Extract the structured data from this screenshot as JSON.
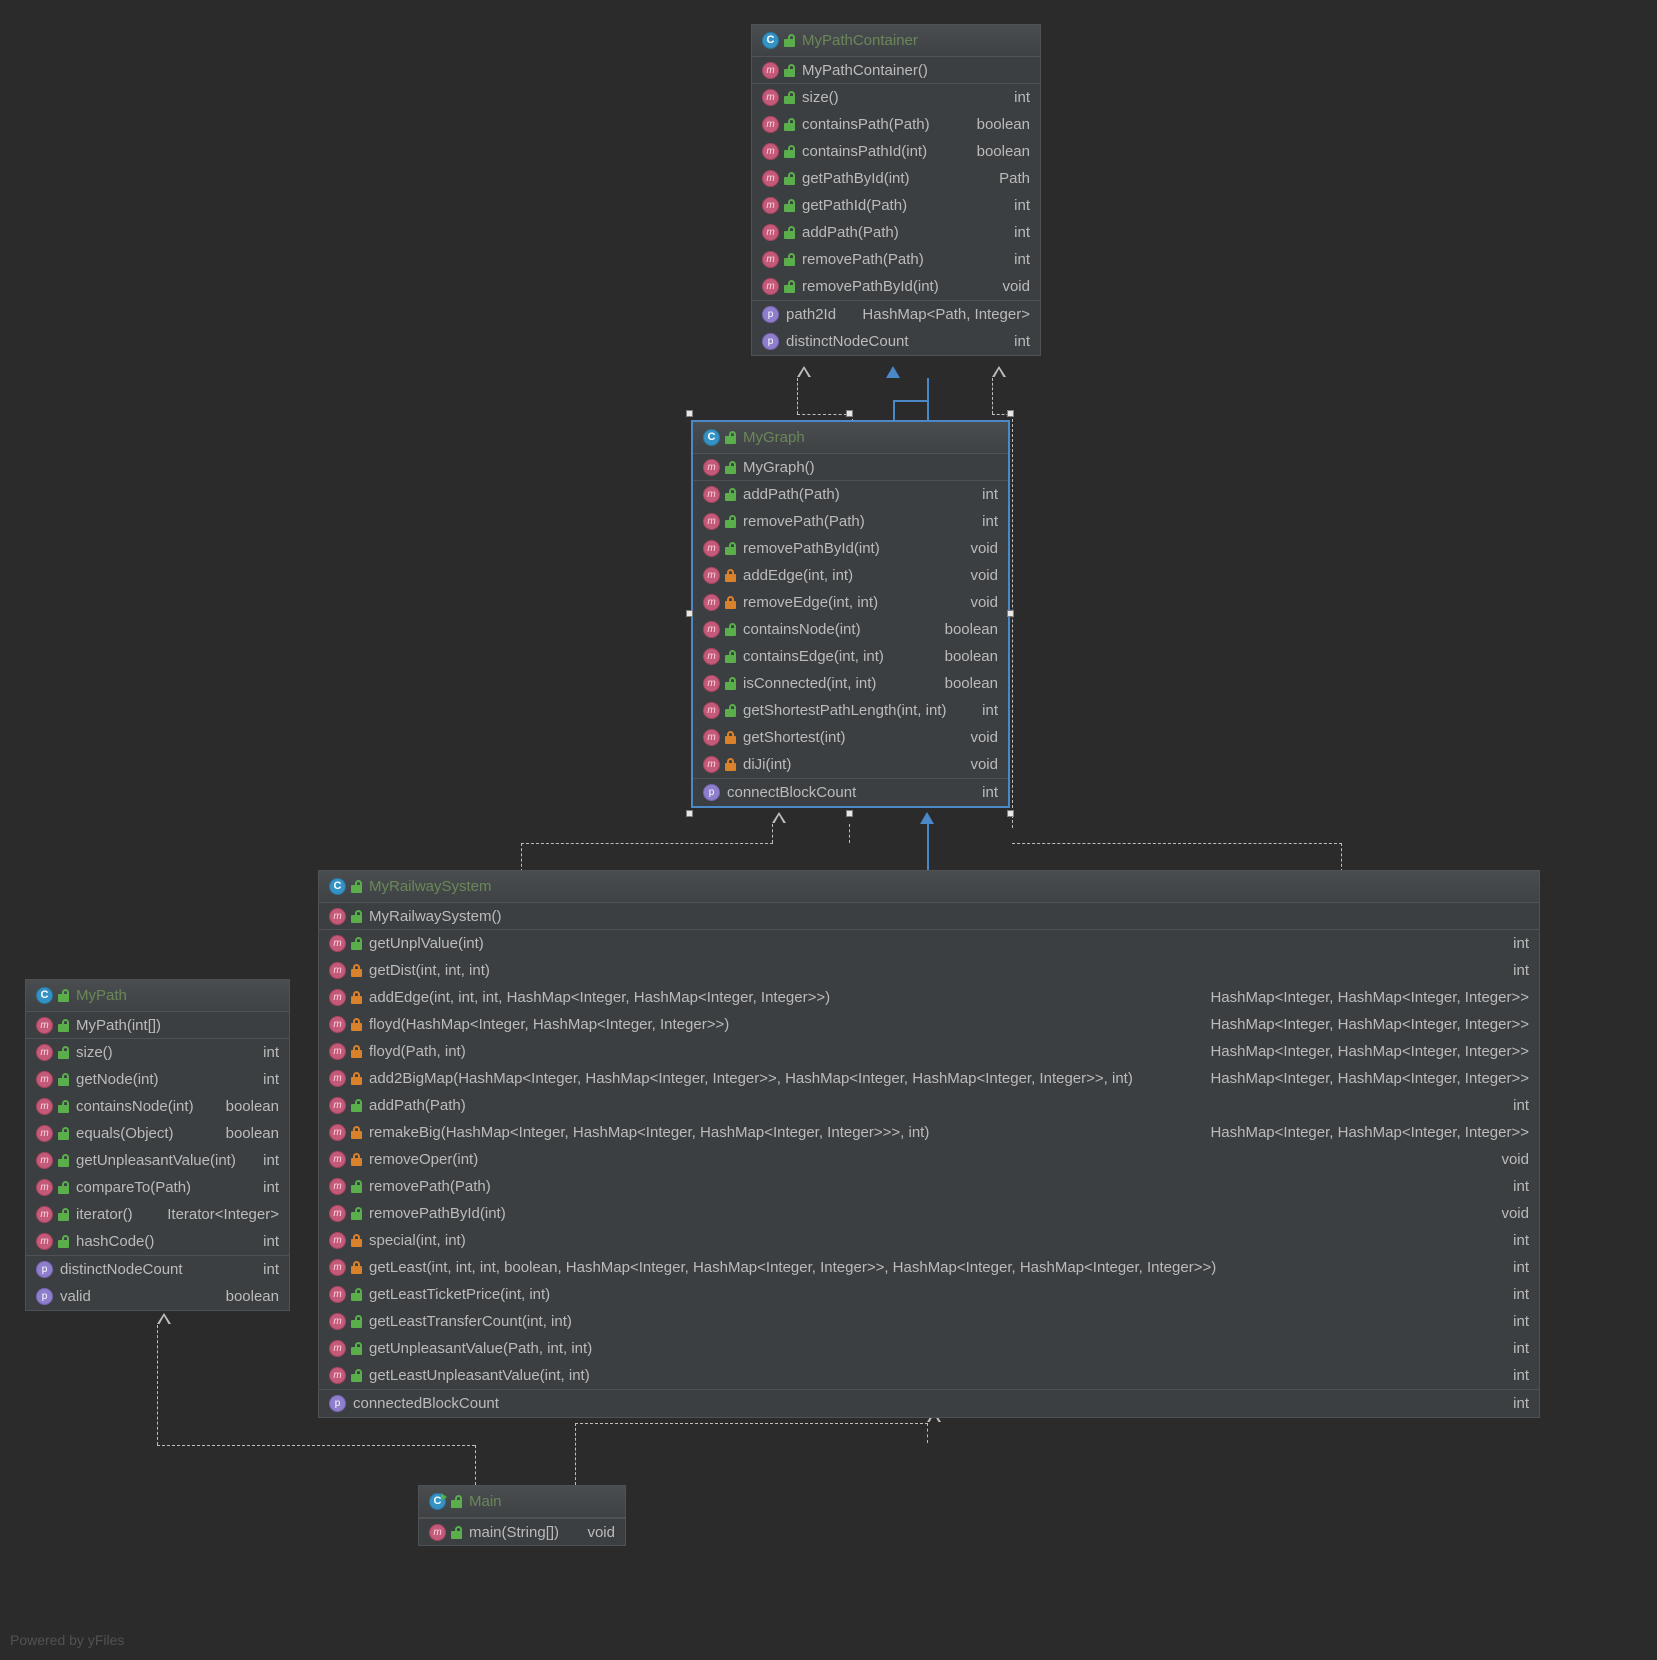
{
  "watermark": "Powered by yFiles",
  "icons": {
    "class": "class-icon",
    "method": "method-icon",
    "field": "field-icon",
    "public": "unlock-icon",
    "private": "lock-icon",
    "runnable": "run-arrow-icon"
  },
  "colors": {
    "background": "#2b2b2b",
    "box_fill": "#3c3f41",
    "box_border": "#4e5254",
    "selection_border": "#4a88c7",
    "class_name": "#6a8759",
    "member_text": "#bbbbbb",
    "class_icon": "#3592c4",
    "method_icon": "#c45a7a",
    "field_icon": "#8f7ecb",
    "public_icon": "#5aaf4c",
    "private_icon": "#d9822b",
    "inheritance_line": "#4a88c7",
    "dependency_line": "#bdbdbd"
  },
  "classes": {
    "mypathcontainer": {
      "name": "MyPathContainer",
      "icon": "class-icon",
      "visibility": "public",
      "constructor": {
        "label": "MyPathContainer()",
        "visibility": "public",
        "rtype": ""
      },
      "methods": [
        {
          "label": "size()",
          "visibility": "public",
          "rtype": "int"
        },
        {
          "label": "containsPath(Path)",
          "visibility": "public",
          "rtype": "boolean"
        },
        {
          "label": "containsPathId(int)",
          "visibility": "public",
          "rtype": "boolean"
        },
        {
          "label": "getPathById(int)",
          "visibility": "public",
          "rtype": "Path"
        },
        {
          "label": "getPathId(Path)",
          "visibility": "public",
          "rtype": "int"
        },
        {
          "label": "addPath(Path)",
          "visibility": "public",
          "rtype": "int"
        },
        {
          "label": "removePath(Path)",
          "visibility": "public",
          "rtype": "int"
        },
        {
          "label": "removePathById(int)",
          "visibility": "public",
          "rtype": "void"
        }
      ],
      "fields": [
        {
          "label": "path2Id",
          "rtype": "HashMap<Path, Integer>"
        },
        {
          "label": "distinctNodeCount",
          "rtype": "int"
        }
      ]
    },
    "mygraph": {
      "name": "MyGraph",
      "icon": "class-icon",
      "visibility": "public",
      "selected": true,
      "constructor": {
        "label": "MyGraph()",
        "visibility": "public",
        "rtype": ""
      },
      "methods": [
        {
          "label": "addPath(Path)",
          "visibility": "public",
          "rtype": "int"
        },
        {
          "label": "removePath(Path)",
          "visibility": "public",
          "rtype": "int"
        },
        {
          "label": "removePathById(int)",
          "visibility": "public",
          "rtype": "void"
        },
        {
          "label": "addEdge(int, int)",
          "visibility": "private",
          "rtype": "void"
        },
        {
          "label": "removeEdge(int, int)",
          "visibility": "private",
          "rtype": "void"
        },
        {
          "label": "containsNode(int)",
          "visibility": "public",
          "rtype": "boolean"
        },
        {
          "label": "containsEdge(int, int)",
          "visibility": "public",
          "rtype": "boolean"
        },
        {
          "label": "isConnected(int, int)",
          "visibility": "public",
          "rtype": "boolean"
        },
        {
          "label": "getShortestPathLength(int, int)",
          "visibility": "public",
          "rtype": "int"
        },
        {
          "label": "getShortest(int)",
          "visibility": "private",
          "rtype": "void"
        },
        {
          "label": "diJi(int)",
          "visibility": "private",
          "rtype": "void"
        }
      ],
      "fields": [
        {
          "label": "connectBlockCount",
          "rtype": "int"
        }
      ]
    },
    "myrailwaysystem": {
      "name": "MyRailwaySystem",
      "icon": "class-icon",
      "visibility": "public",
      "constructor": {
        "label": "MyRailwaySystem()",
        "visibility": "public",
        "rtype": ""
      },
      "methods": [
        {
          "label": "getUnplValue(int)",
          "visibility": "public",
          "rtype": "int"
        },
        {
          "label": "getDist(int, int, int)",
          "visibility": "private",
          "rtype": "int"
        },
        {
          "label": "addEdge(int, int, int, HashMap<Integer, HashMap<Integer, Integer>>)",
          "visibility": "private",
          "rtype": "HashMap<Integer, HashMap<Integer, Integer>>"
        },
        {
          "label": "floyd(HashMap<Integer, HashMap<Integer, Integer>>)",
          "visibility": "private",
          "rtype": "HashMap<Integer, HashMap<Integer, Integer>>"
        },
        {
          "label": "floyd(Path, int)",
          "visibility": "private",
          "rtype": "HashMap<Integer, HashMap<Integer, Integer>>"
        },
        {
          "label": "add2BigMap(HashMap<Integer, HashMap<Integer, Integer>>, HashMap<Integer, HashMap<Integer, Integer>>, int)",
          "visibility": "private",
          "rtype": "HashMap<Integer, HashMap<Integer, Integer>>"
        },
        {
          "label": "addPath(Path)",
          "visibility": "public",
          "rtype": "int"
        },
        {
          "label": "remakeBig(HashMap<Integer, HashMap<Integer, HashMap<Integer, Integer>>>, int)",
          "visibility": "private",
          "rtype": "HashMap<Integer, HashMap<Integer, Integer>>"
        },
        {
          "label": "removeOper(int)",
          "visibility": "private",
          "rtype": "void"
        },
        {
          "label": "removePath(Path)",
          "visibility": "public",
          "rtype": "int"
        },
        {
          "label": "removePathById(int)",
          "visibility": "public",
          "rtype": "void"
        },
        {
          "label": "special(int, int)",
          "visibility": "private",
          "rtype": "int"
        },
        {
          "label": "getLeast(int, int, int, boolean, HashMap<Integer, HashMap<Integer, Integer>>, HashMap<Integer, HashMap<Integer, Integer>>)",
          "visibility": "private",
          "rtype": "int"
        },
        {
          "label": "getLeastTicketPrice(int, int)",
          "visibility": "public",
          "rtype": "int"
        },
        {
          "label": "getLeastTransferCount(int, int)",
          "visibility": "public",
          "rtype": "int"
        },
        {
          "label": "getUnpleasantValue(Path, int, int)",
          "visibility": "public",
          "rtype": "int"
        },
        {
          "label": "getLeastUnpleasantValue(int, int)",
          "visibility": "public",
          "rtype": "int"
        }
      ],
      "fields": [
        {
          "label": "connectedBlockCount",
          "rtype": "int"
        }
      ]
    },
    "mypath": {
      "name": "MyPath",
      "icon": "class-icon",
      "visibility": "public",
      "constructor": {
        "label": "MyPath(int[])",
        "visibility": "public",
        "rtype": ""
      },
      "methods": [
        {
          "label": "size()",
          "visibility": "public",
          "rtype": "int"
        },
        {
          "label": "getNode(int)",
          "visibility": "public",
          "rtype": "int"
        },
        {
          "label": "containsNode(int)",
          "visibility": "public",
          "rtype": "boolean"
        },
        {
          "label": "equals(Object)",
          "visibility": "public",
          "rtype": "boolean"
        },
        {
          "label": "getUnpleasantValue(int)",
          "visibility": "public",
          "rtype": "int"
        },
        {
          "label": "compareTo(Path)",
          "visibility": "public",
          "rtype": "int"
        },
        {
          "label": "iterator()",
          "visibility": "public",
          "rtype": "Iterator<Integer>"
        },
        {
          "label": "hashCode()",
          "visibility": "public",
          "rtype": "int"
        }
      ],
      "fields": [
        {
          "label": "distinctNodeCount",
          "rtype": "int"
        },
        {
          "label": "valid",
          "rtype": "boolean"
        }
      ]
    },
    "main": {
      "name": "Main",
      "icon": "class-icon",
      "visibility": "public",
      "runnable": true,
      "constructor": null,
      "methods": [
        {
          "label": "main(String[])",
          "visibility": "public",
          "rtype": "void"
        }
      ],
      "fields": []
    }
  }
}
